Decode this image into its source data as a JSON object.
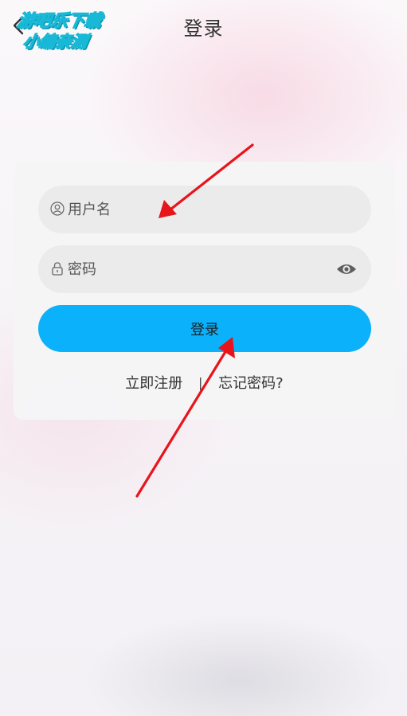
{
  "header": {
    "title": "登录"
  },
  "watermark": {
    "line1": "游吧乐下载",
    "line2": "小编亲测"
  },
  "login_form": {
    "username": {
      "placeholder": "用户名",
      "icon": "user-icon"
    },
    "password": {
      "placeholder": "密码",
      "icon": "lock-icon",
      "toggle_icon": "eye-icon"
    },
    "submit_label": "登录",
    "register_link": "立即注册",
    "separator": "|",
    "forgot_link": "忘记密码?"
  },
  "colors": {
    "primary_button": "#0bb1fa",
    "annotation_arrow": "#e8141b",
    "watermark": "#18b9d6"
  }
}
